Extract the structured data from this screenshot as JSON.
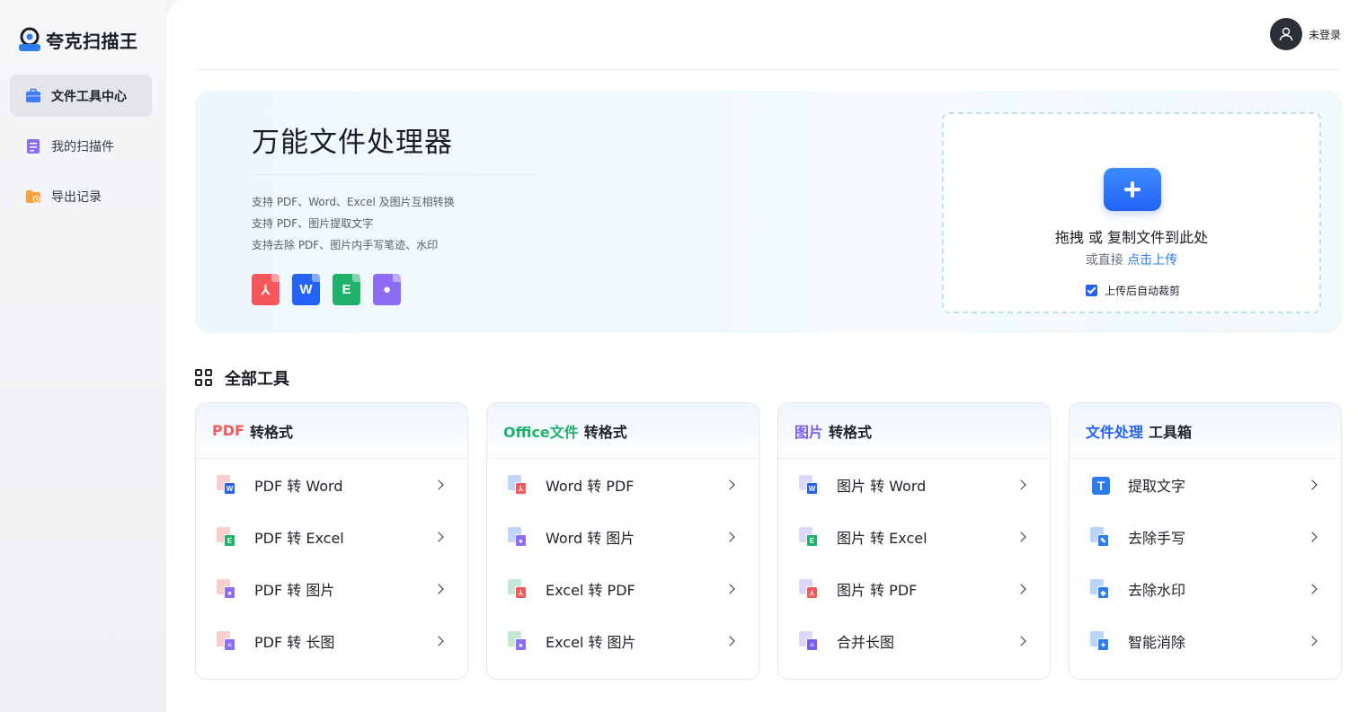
{
  "app": {
    "name": "夸克扫描王",
    "logo_badge": "扫描王"
  },
  "sidebar": {
    "items": [
      {
        "label": "文件工具中心",
        "icon": "briefcase-icon",
        "active": true
      },
      {
        "label": "我的扫描件",
        "icon": "document-icon",
        "active": false
      },
      {
        "label": "导出记录",
        "icon": "folder-clock-icon",
        "active": false
      }
    ]
  },
  "header": {
    "user_label": "未登录"
  },
  "hero": {
    "title": "万能文件处理器",
    "lines": [
      "支持 PDF、Word、Excel 及图片互相转换",
      "支持 PDF、图片提取文字",
      "支持去除 PDF、图片内手写笔迹、水印"
    ],
    "file_types": [
      {
        "name": "pdf-file-icon",
        "glyph": "⅄",
        "color": "#f4585b"
      },
      {
        "name": "word-file-icon",
        "glyph": "W",
        "color": "#2463f5"
      },
      {
        "name": "excel-file-icon",
        "glyph": "E",
        "color": "#1fb26b"
      },
      {
        "name": "image-file-icon",
        "glyph": "●",
        "color": "#8c6cf2"
      }
    ],
    "upload": {
      "main": "拖拽 或 复制文件到此处",
      "sub_prefix": "或直接 ",
      "sub_link": "点击上传",
      "auto_crop": "上传后自动裁剪",
      "auto_crop_checked": true
    }
  },
  "tools_section": {
    "title": "全部工具",
    "cards": [
      {
        "accent": "PDF",
        "accent_color": "#f4585b",
        "title": "转格式",
        "tools": [
          {
            "label": "PDF 转 Word",
            "back": "#f4a5a6",
            "front": "#2463f5",
            "glyph": "W"
          },
          {
            "label": "PDF 转 Excel",
            "back": "#f4a5a6",
            "front": "#1fb26b",
            "glyph": "E"
          },
          {
            "label": "PDF 转 图片",
            "back": "#f4a5a6",
            "front": "#8c6cf2",
            "glyph": "●"
          },
          {
            "label": "PDF 转 长图",
            "back": "#f4a5a6",
            "front": "#8c6cf2",
            "glyph": "≡"
          }
        ]
      },
      {
        "accent": "Office文件",
        "accent_color": "#1fb26b",
        "title": "转格式",
        "tools": [
          {
            "label": "Word 转 PDF",
            "back": "#8fb0f8",
            "front": "#f4585b",
            "glyph": "⅄"
          },
          {
            "label": "Word 转 图片",
            "back": "#8fb0f8",
            "front": "#8c6cf2",
            "glyph": "●"
          },
          {
            "label": "Excel 转 PDF",
            "back": "#8fd6b1",
            "front": "#f4585b",
            "glyph": "⅄"
          },
          {
            "label": "Excel 转 图片",
            "back": "#8fd6b1",
            "front": "#8c6cf2",
            "glyph": "●"
          }
        ]
      },
      {
        "accent": "图片",
        "accent_color": "#7a5cf0",
        "title": "转格式",
        "tools": [
          {
            "label": "图片 转 Word",
            "back": "#c4b5f8",
            "front": "#2463f5",
            "glyph": "W"
          },
          {
            "label": "图片 转 Excel",
            "back": "#c4b5f8",
            "front": "#1fb26b",
            "glyph": "E"
          },
          {
            "label": "图片 转 PDF",
            "back": "#c4b5f8",
            "front": "#f4585b",
            "glyph": "⅄"
          },
          {
            "label": "合并长图",
            "back": "#c4b5f8",
            "front": "#7a5cf0",
            "glyph": "≡"
          }
        ]
      },
      {
        "accent": "文件处理",
        "accent_color": "#2463f5",
        "title": "工具箱",
        "tools": [
          {
            "label": "提取文字",
            "back": "#2b7bf2",
            "front": "#2b7bf2",
            "glyph": "T"
          },
          {
            "label": "去除手写",
            "back": "#7fb0fb",
            "front": "#2b7bf2",
            "glyph": "✎"
          },
          {
            "label": "去除水印",
            "back": "#7fb0fb",
            "front": "#2b7bf2",
            "glyph": "◆"
          },
          {
            "label": "智能消除",
            "back": "#7fb0fb",
            "front": "#2b7bf2",
            "glyph": "✦"
          }
        ]
      }
    ]
  }
}
